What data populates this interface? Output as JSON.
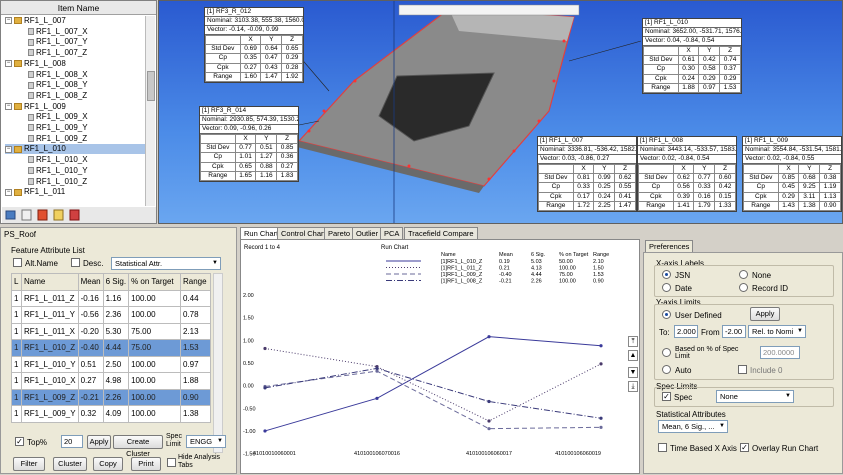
{
  "tree": {
    "header": "Item Name",
    "items": [
      {
        "label": "RF1_L_007",
        "level": 0,
        "type": "group"
      },
      {
        "label": "RF1_L_007_X",
        "level": 1,
        "type": "leaf"
      },
      {
        "label": "RF1_L_007_Y",
        "level": 1,
        "type": "leaf"
      },
      {
        "label": "RF1_L_007_Z",
        "level": 1,
        "type": "leaf"
      },
      {
        "label": "RF1_L_008",
        "level": 0,
        "type": "group"
      },
      {
        "label": "RF1_L_008_X",
        "level": 1,
        "type": "leaf"
      },
      {
        "label": "RF1_L_008_Y",
        "level": 1,
        "type": "leaf"
      },
      {
        "label": "RF1_L_008_Z",
        "level": 1,
        "type": "leaf"
      },
      {
        "label": "RF1_L_009",
        "level": 0,
        "type": "group"
      },
      {
        "label": "RF1_L_009_X",
        "level": 1,
        "type": "leaf"
      },
      {
        "label": "RF1_L_009_Y",
        "level": 1,
        "type": "leaf"
      },
      {
        "label": "RF1_L_009_Z",
        "level": 1,
        "type": "leaf"
      },
      {
        "label": "RF1_L_010",
        "level": 0,
        "type": "group",
        "selected": true
      },
      {
        "label": "RF1_L_010_X",
        "level": 1,
        "type": "leaf"
      },
      {
        "label": "RF1_L_010_Y",
        "level": 1,
        "type": "leaf"
      },
      {
        "label": "RF1_L_010_Z",
        "level": 1,
        "type": "leaf"
      },
      {
        "label": "RF1_L_011",
        "level": 0,
        "type": "group"
      }
    ]
  },
  "viewport": {
    "cards": [
      {
        "title": "[1] RF3_R_012",
        "nominal": "Nominal: 3103.38, 555.38, 1560.0",
        "vector": "Vector: -0.14, -0.09, 0.99",
        "rows": [
          [
            "Std Dev",
            "0.69",
            "0.64",
            "0.65"
          ],
          [
            "Cp",
            "0.35",
            "0.47",
            "0.29"
          ],
          [
            "Cpk",
            "0.27",
            "0.43",
            "0.28"
          ],
          [
            "Range",
            "1.60",
            "1.47",
            "1.92"
          ]
        ]
      },
      {
        "title": "[1] RF1_L_010",
        "nominal": "Nominal: 3652.00, -531.71, 1576.2",
        "vector": "Vector: 0.04, -0.84, 0.54",
        "rows": [
          [
            "Std Dev",
            "0.61",
            "0.42",
            "0.74"
          ],
          [
            "Cp",
            "0.30",
            "0.58",
            "0.37"
          ],
          [
            "Cpk",
            "0.24",
            "0.29",
            "0.29"
          ],
          [
            "Range",
            "1.88",
            "0.97",
            "1.53"
          ]
        ]
      },
      {
        "title": "[1] RF3_R_014",
        "nominal": "Nominal: 2930.85, 574.39, 1530.2",
        "vector": "Vector: 0.09, -0.96, 0.26",
        "rows": [
          [
            "Std Dev",
            "0.77",
            "0.51",
            "0.85"
          ],
          [
            "Cp",
            "1.01",
            "1.27",
            "0.36"
          ],
          [
            "Cpk",
            "0.65",
            "0.88",
            "0.27"
          ],
          [
            "Range",
            "1.65",
            "1.16",
            "1.83"
          ]
        ]
      },
      {
        "title": "[1] RF1_L_007",
        "nominal": "Nominal: 3336.81, -536.42, 1582.3",
        "vector": "Vector: 0.03, -0.86, 0.27",
        "rows": [
          [
            "Std Dev",
            "0.81",
            "0.99",
            "0.62"
          ],
          [
            "Cp",
            "0.33",
            "0.25",
            "0.55"
          ],
          [
            "Cpk",
            "0.17",
            "0.24",
            "0.41"
          ],
          [
            "Range",
            "1.72",
            "2.25",
            "1.47"
          ]
        ]
      },
      {
        "title": "[1] RF1_L_008",
        "nominal": "Nominal: 3443.14, -533.57, 1583.5",
        "vector": "Vector: 0.02, -0.84, 0.54",
        "rows": [
          [
            "Std Dev",
            "0.62",
            "0.77",
            "0.60"
          ],
          [
            "Cp",
            "0.56",
            "0.33",
            "0.42"
          ],
          [
            "Cpk",
            "0.39",
            "0.16",
            "0.15"
          ],
          [
            "Range",
            "1.41",
            "1.79",
            "1.33"
          ]
        ]
      },
      {
        "title": "[1] RF1_L_009",
        "nominal": "Nominal: 3554.84, -531.54, 1581.9",
        "vector": "Vector: 0.02, -0.84, 0.55",
        "rows": [
          [
            "Std Dev",
            "0.85",
            "0.68",
            "0.38"
          ],
          [
            "Cp",
            "0.45",
            "9.25",
            "1.19"
          ],
          [
            "Cpk",
            "0.29",
            "3.11",
            "1.13"
          ],
          [
            "Range",
            "1.43",
            "1.38",
            "0.90"
          ]
        ]
      }
    ],
    "cols": [
      "X",
      "Y",
      "Z"
    ]
  },
  "left": {
    "title": "PS_Roof",
    "subtitle": "Feature Attribute List",
    "alt_name": "Alt.Name",
    "desc": "Desc.",
    "stat_select": "Statistical Attr.",
    "columns": [
      "L",
      "Name",
      "Mean",
      "6 Sig.",
      "% on Target",
      "Range"
    ],
    "rows": [
      [
        "1",
        "RF1_L_011_Z",
        "-0.16",
        "1.16",
        "100.00",
        "0.44"
      ],
      [
        "1",
        "RF1_L_011_Y",
        "-0.56",
        "2.36",
        "100.00",
        "0.78"
      ],
      [
        "1",
        "RF1_L_011_X",
        "-0.20",
        "5.30",
        "75.00",
        "2.13"
      ],
      [
        "1",
        "RF1_L_010_Z",
        "-0.40",
        "4.44",
        "75.00",
        "1.53"
      ],
      [
        "1",
        "RF1_L_010_Y",
        "0.51",
        "2.50",
        "100.00",
        "0.97"
      ],
      [
        "1",
        "RF1_L_010_X",
        "0.27",
        "4.98",
        "100.00",
        "1.88"
      ],
      [
        "1",
        "RF1_L_009_Z",
        "-0.21",
        "2.26",
        "100.00",
        "0.90"
      ],
      [
        "1",
        "RF1_L_009_Y",
        "0.32",
        "4.09",
        "100.00",
        "1.38"
      ]
    ],
    "highlighted_rows": [
      3,
      6
    ],
    "top_label": "Top%",
    "top_value": "20",
    "apply": "Apply",
    "create_cluster": "Create Cluster",
    "spec_limit": "Spec Limit",
    "spec_select": "ENGG",
    "filter": "Filter",
    "cluster": "Cluster",
    "copy": "Copy",
    "print": "Print",
    "hide_tabs": "Hide Analysis Tabs"
  },
  "tabs": [
    "Run Chart",
    "Control Chart",
    "Pareto",
    "Outlier",
    "PCA",
    "Tracefield Compare"
  ],
  "chart_data": {
    "type": "line",
    "title": "Run Chart",
    "record_label": "Record 1 to 4",
    "categories": [
      "41010010060001",
      "410100106070016",
      "410100106060017",
      "410100106060019"
    ],
    "ylim": [
      -1.2,
      2.0
    ],
    "yticks": [
      "2.00",
      "1.50",
      "1.00",
      "0.50",
      "0.00",
      "-0.50",
      "-1.00",
      "-1.50"
    ],
    "legend_headers": [
      "Name",
      "Mean",
      "6 Sig.",
      "% on Target",
      "Range"
    ],
    "series": [
      {
        "name": "[1]RF1_L_010_Z",
        "mean": "0.19",
        "sig": "5.03",
        "target": "50.00",
        "range": "2.10",
        "values": [
          -1.0,
          -0.28,
          1.08,
          0.88
        ],
        "style": "solid"
      },
      {
        "name": "[1]RF1_L_011_Z",
        "mean": "0.21",
        "sig": "4.13",
        "target": "100.00",
        "range": "1.50",
        "values": [
          0.82,
          0.42,
          -0.78,
          0.48
        ],
        "style": "dotted"
      },
      {
        "name": "[1]RF1_L_009_Z",
        "mean": "-0.40",
        "sig": "4.44",
        "target": "75.00",
        "range": "1.53",
        "values": [
          -0.02,
          0.32,
          -0.95,
          -0.92
        ],
        "style": "dashed"
      },
      {
        "name": "[1]RF1_L_008_Z",
        "mean": "-0.21",
        "sig": "2.26",
        "target": "100.00",
        "range": "0.90",
        "values": [
          -0.05,
          0.38,
          -0.35,
          -0.72
        ],
        "style": "dashdot"
      }
    ]
  },
  "prefs": {
    "tab": "Preferences",
    "xaxis_labels": "X-axis Labels",
    "opt_jsn": "JSN",
    "opt_none": "None",
    "opt_date": "Date",
    "opt_record": "Record ID",
    "yaxis_limits": "Y-axis Limits",
    "user_defined": "User Defined",
    "apply": "Apply",
    "to_label": "To:",
    "to_value": "2.000",
    "from_label": "From",
    "from_value": "-2.00",
    "rel_nominal": "Rel. to Nomi",
    "based_on": "Based on % of Spec Limit",
    "based_value": "200.0000",
    "auto": "Auto",
    "include0": "Include 0",
    "spec_limits": "Spec Limits",
    "spec": "Spec",
    "spec_select": "None",
    "stat_attrs": "Statistical Attributes",
    "stat_select": "Mean, 6 Sig., ...",
    "time_based": "Time Based X Axis",
    "overlay": "Overlay Run Chart"
  }
}
